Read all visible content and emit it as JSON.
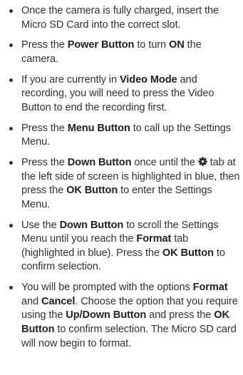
{
  "steps": [
    {
      "parts": [
        {
          "t": "Once the camera is fully charged, insert the Micro SD Card into the correct slot."
        }
      ]
    },
    {
      "parts": [
        {
          "t": "Press the "
        },
        {
          "t": "Power Button",
          "b": true
        },
        {
          "t": " to turn "
        },
        {
          "t": "ON",
          "b": true
        },
        {
          "t": " the camera."
        }
      ]
    },
    {
      "parts": [
        {
          "t": "If you are currently in "
        },
        {
          "t": "Video Mode",
          "b": true
        },
        {
          "t": " and recording, you will need to press the Video Button to end the recording first."
        }
      ]
    },
    {
      "parts": [
        {
          "t": "Press the "
        },
        {
          "t": "Menu Button",
          "b": true
        },
        {
          "t": " to call up the Settings Menu."
        }
      ]
    },
    {
      "parts": [
        {
          "t": "Press the "
        },
        {
          "t": "Down Button",
          "b": true
        },
        {
          "t": " once until the "
        },
        {
          "icon": "gear-icon"
        },
        {
          "t": " tab at the left side of screen is highlighted in blue, then press the "
        },
        {
          "t": "OK Button",
          "b": true
        },
        {
          "t": " to enter the Settings Menu."
        }
      ]
    },
    {
      "parts": [
        {
          "t": "Use the "
        },
        {
          "t": "Down Button",
          "b": true
        },
        {
          "t": " to scroll the Settings Menu until you reach the "
        },
        {
          "t": "Format",
          "b": true
        },
        {
          "t": " tab (highlighted in blue). Press the "
        },
        {
          "t": "OK Button",
          "b": true
        },
        {
          "t": " to confirm selection."
        }
      ]
    },
    {
      "parts": [
        {
          "t": "You will be prompted with the options "
        },
        {
          "t": "Format",
          "b": true
        },
        {
          "t": " and "
        },
        {
          "t": "Cancel",
          "b": true
        },
        {
          "t": ". Choose the option that you require using the "
        },
        {
          "t": "Up/Down Button",
          "b": true
        },
        {
          "t": " and press the "
        },
        {
          "t": "OK Button",
          "b": true
        },
        {
          "t": " to confirm selection. The Micro SD card will now begin to format."
        }
      ]
    }
  ],
  "colors": {
    "text": "#333333",
    "bold": "#222222",
    "background": "#ffffff"
  }
}
